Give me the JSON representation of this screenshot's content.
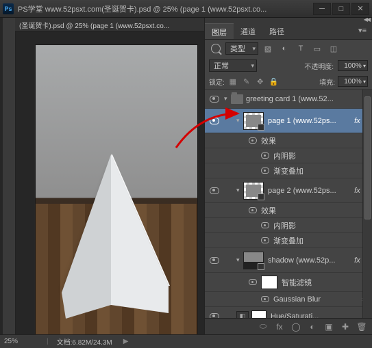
{
  "titlebar": {
    "app_badge": "Ps",
    "title": "PS学堂 www.52psxt.com(圣诞贺卡).psd @ 25% (page 1 (www.52psxt.co..."
  },
  "doc_tab": "(圣诞贺卡).psd @ 25% (page 1 (www.52psxt.co...",
  "panel": {
    "tabs": [
      "图层",
      "通道",
      "路径"
    ],
    "active_tab": 0,
    "kind_label": "类型",
    "blend_mode": "正常",
    "opacity_label": "不透明度:",
    "opacity_value": "100%",
    "lock_label": "锁定:",
    "fill_label": "填充:",
    "fill_value": "100%"
  },
  "layers": {
    "group": "greeting card 1 (www.52...",
    "page1": {
      "label": "page 1 (www.52ps...",
      "fx": "fx",
      "effects": "效果",
      "inner_shadow": "内阴影",
      "grad_overlay": "渐变叠加"
    },
    "page2": {
      "label": "page 2 (www.52ps...",
      "fx": "fx",
      "effects": "效果",
      "inner_shadow": "内阴影",
      "grad_overlay": "渐变叠加"
    },
    "shadow": {
      "label": "shadow (www.52p...",
      "fx": "fx",
      "smart_filters": "智能滤镜",
      "gaussian": "Gaussian Blur"
    },
    "huesat": {
      "label": "Hue/Saturati..."
    }
  },
  "status": {
    "zoom": "25%",
    "doc_size": "文档:6.82M/24.3M"
  }
}
